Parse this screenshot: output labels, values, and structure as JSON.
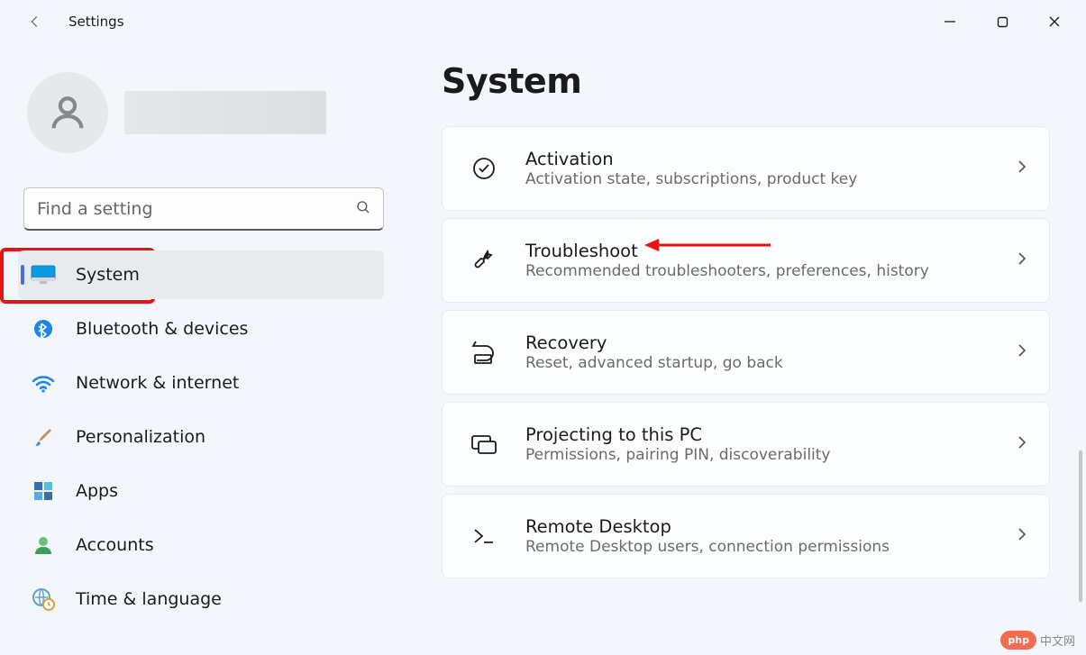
{
  "app_title": "Settings",
  "search": {
    "placeholder": "Find a setting"
  },
  "nav": {
    "items": [
      {
        "id": "system",
        "label": "System",
        "active": true
      },
      {
        "id": "bluetooth",
        "label": "Bluetooth & devices"
      },
      {
        "id": "network",
        "label": "Network & internet"
      },
      {
        "id": "personalization",
        "label": "Personalization"
      },
      {
        "id": "apps",
        "label": "Apps"
      },
      {
        "id": "accounts",
        "label": "Accounts"
      },
      {
        "id": "time",
        "label": "Time & language"
      }
    ]
  },
  "page_heading": "System",
  "cards": [
    {
      "icon": "check-circle",
      "title": "Activation",
      "subtitle": "Activation state, subscriptions, product key"
    },
    {
      "icon": "wrench",
      "title": "Troubleshoot",
      "subtitle": "Recommended troubleshooters, preferences, history"
    },
    {
      "icon": "revert",
      "title": "Recovery",
      "subtitle": "Reset, advanced startup, go back"
    },
    {
      "icon": "project",
      "title": "Projecting to this PC",
      "subtitle": "Permissions, pairing PIN, discoverability"
    },
    {
      "icon": "remote",
      "title": "Remote Desktop",
      "subtitle": "Remote Desktop users, connection permissions"
    }
  ],
  "watermark": {
    "badge": "php",
    "text": "中文网"
  },
  "annotation": {
    "arrow_color": "#e11",
    "highlight_color": "#e11"
  }
}
